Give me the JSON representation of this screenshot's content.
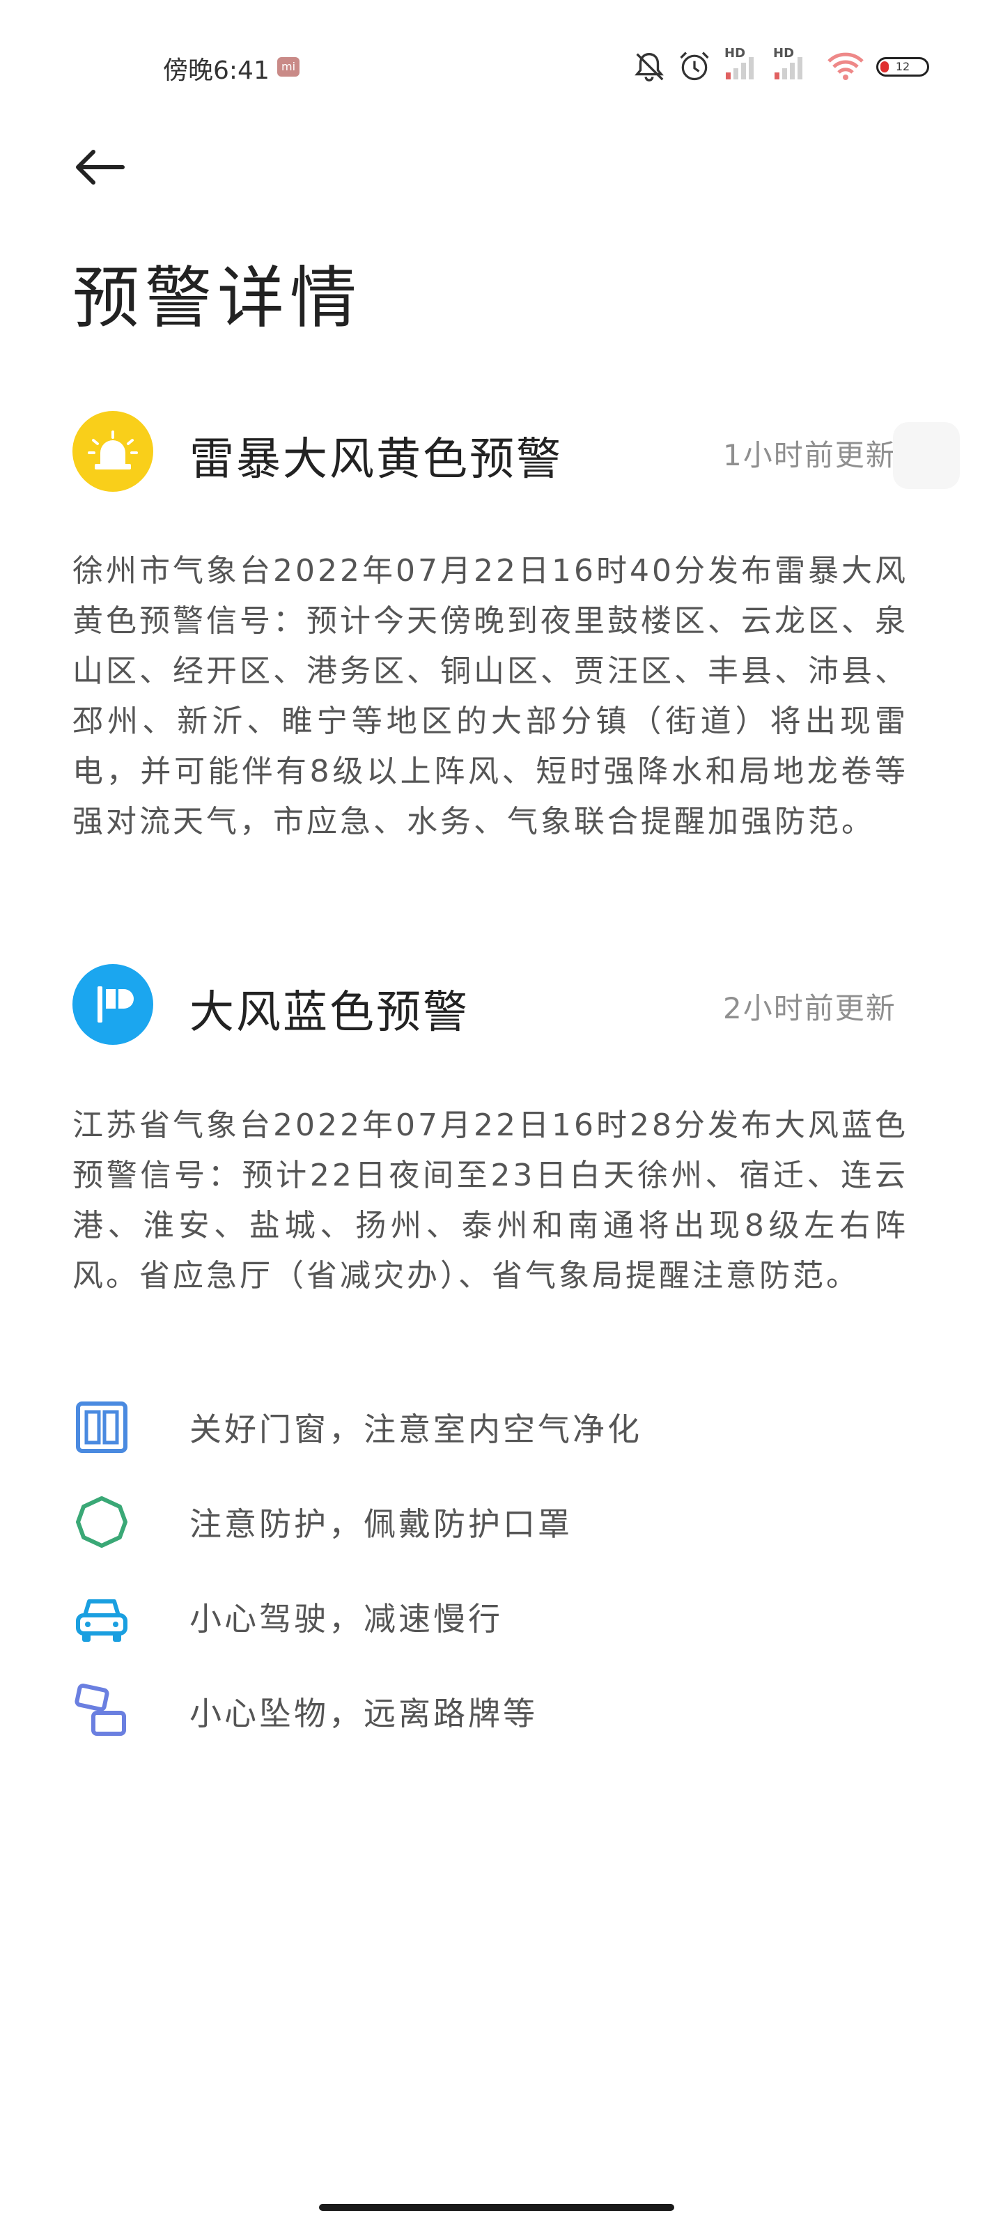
{
  "status_bar": {
    "time": "傍晚6:41",
    "mi_badge": "mi",
    "battery_level": "12",
    "hd_label_1": "HD",
    "hd_label_2": "HD",
    "icons": [
      "mute-bell-icon",
      "alarm-icon",
      "signal-hd-icon",
      "signal-hd-icon",
      "wifi-icon",
      "battery-icon"
    ]
  },
  "header": {
    "back_icon": "arrow-left-icon",
    "title": "预警详情"
  },
  "alerts": [
    {
      "title": "雷暴大风黄色预警",
      "updated": "1小时前更新",
      "icon": "alarm-light-icon",
      "color": "#f9cf1a",
      "body": "徐州市气象台2022年07月22日16时40分发布雷暴大风黄色预警信号：预计今天傍晚到夜里鼓楼区、云龙区、泉山区、经开区、港务区、铜山区、贾汪区、丰县、沛县、邳州、新沂、睢宁等地区的大部分镇（街道）将出现雷电，并可能伴有8级以上阵风、短时强降水和局地龙卷等强对流天气，市应急、水务、气象联合提醒加强防范。"
    },
    {
      "title": "大风蓝色预警",
      "updated": "2小时前更新",
      "icon": "wind-flag-icon",
      "color": "#1ba6ef",
      "body": "江苏省气象台2022年07月22日16时28分发布大风蓝色预警信号：预计22日夜间至23日白天徐州、宿迁、连云港、淮安、盐城、扬州、泰州和南通将出现8级左右阵风。省应急厅（省减灾办）、省气象局提醒注意防范。"
    }
  ],
  "tips": [
    {
      "text": "关好门窗，注意室内空气净化",
      "icon": "window-icon",
      "color": "#4a8ae0"
    },
    {
      "text": "注意防护，佩戴防护口罩",
      "icon": "mask-icon",
      "color": "#3aa876"
    },
    {
      "text": "小心驾驶，减速慢行",
      "icon": "car-icon",
      "color": "#1a9fe0"
    },
    {
      "text": "小心坠物，远离路牌等",
      "icon": "falling-objects-icon",
      "color": "#6a7fe0"
    }
  ]
}
